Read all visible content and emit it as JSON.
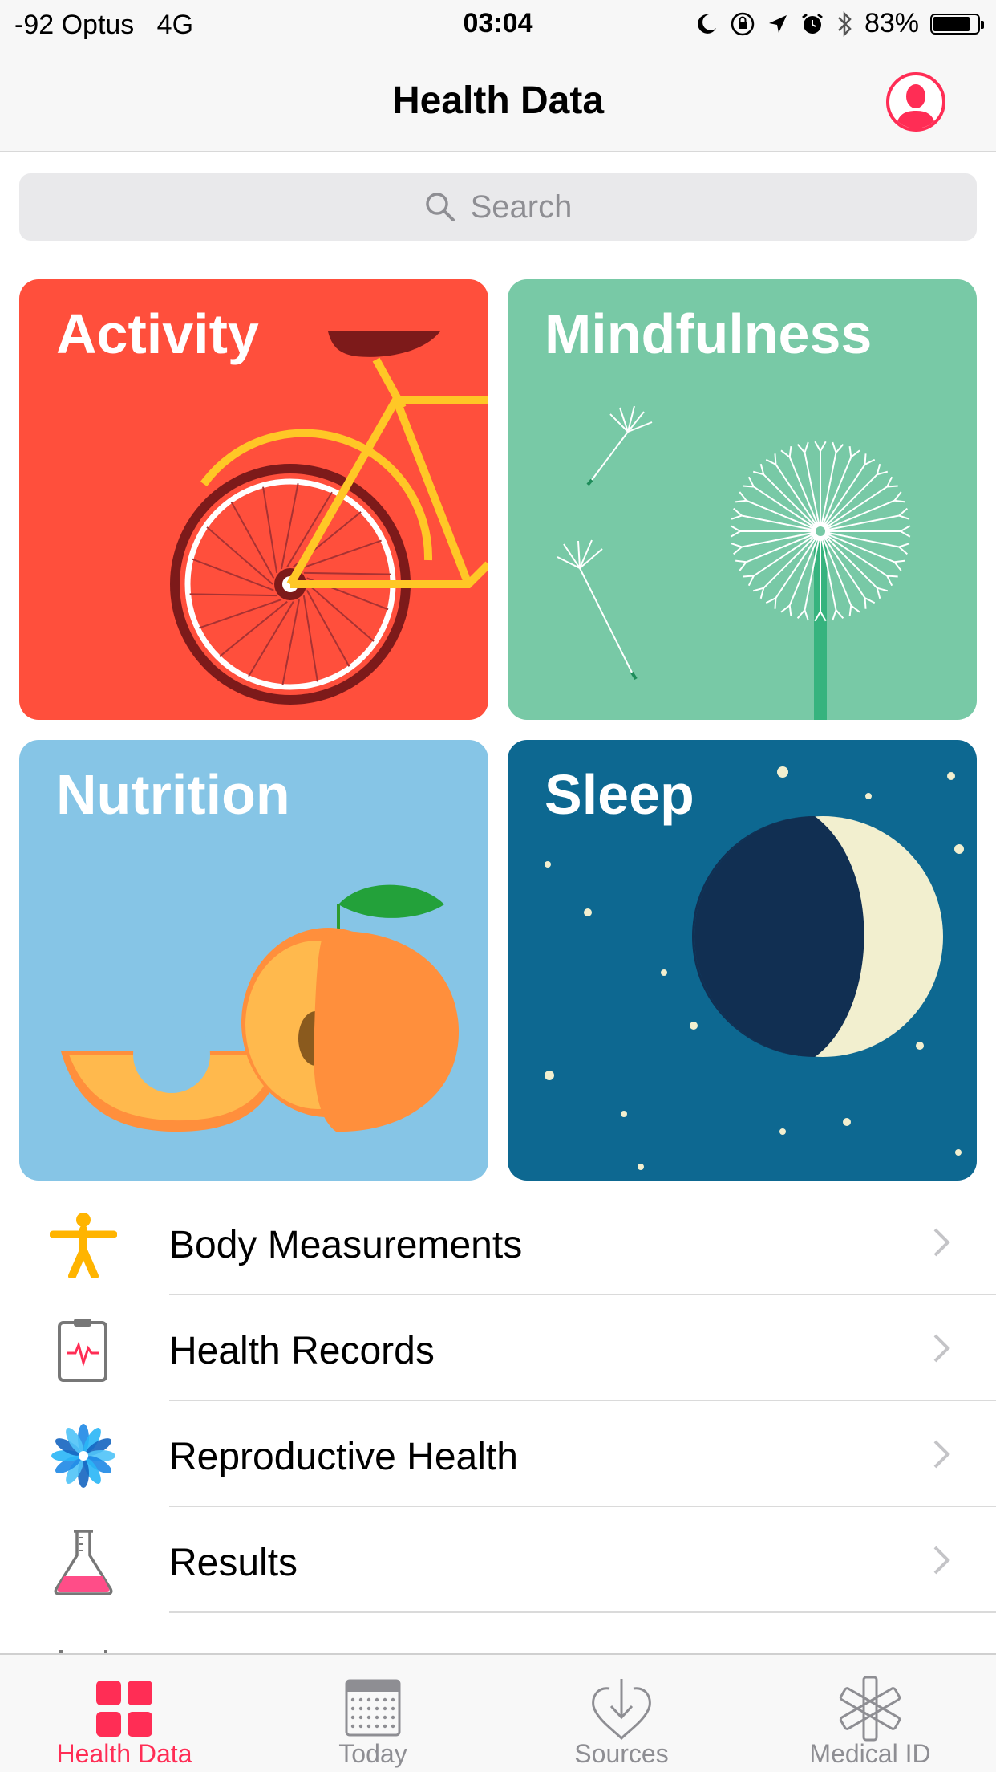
{
  "status_bar": {
    "carrier": "-92 Optus",
    "network": "4G",
    "time": "03:04",
    "battery": "83%",
    "battery_level": 0.83,
    "icons": [
      "moon-icon",
      "rotation-lock-icon",
      "location-icon",
      "alarm-icon",
      "bluetooth-icon",
      "battery-icon"
    ]
  },
  "nav": {
    "title": "Health Data",
    "profile_icon": "profile-icon"
  },
  "search": {
    "placeholder": "Search",
    "icon": "search-icon"
  },
  "categories": [
    {
      "title": "Activity",
      "color": "#ff4f3c"
    },
    {
      "title": "Mindfulness",
      "color": "#78c9a6"
    },
    {
      "title": "Nutrition",
      "color": "#86c5e6"
    },
    {
      "title": "Sleep",
      "color": "#0d6891"
    }
  ],
  "list": [
    {
      "label": "Body Measurements",
      "icon": "body-figure-icon"
    },
    {
      "label": "Health Records",
      "icon": "clipboard-heart-icon"
    },
    {
      "label": "Reproductive Health",
      "icon": "flower-icon"
    },
    {
      "label": "Results",
      "icon": "flask-icon"
    }
  ],
  "tabs": [
    {
      "label": "Health Data",
      "icon": "grid-icon",
      "active": true
    },
    {
      "label": "Today",
      "icon": "calendar-icon",
      "active": false
    },
    {
      "label": "Sources",
      "icon": "download-heart-icon",
      "active": false
    },
    {
      "label": "Medical ID",
      "icon": "asterisk-icon",
      "active": false
    }
  ],
  "colors": {
    "accent": "#ff2d55",
    "inactive": "#8e8e93"
  }
}
